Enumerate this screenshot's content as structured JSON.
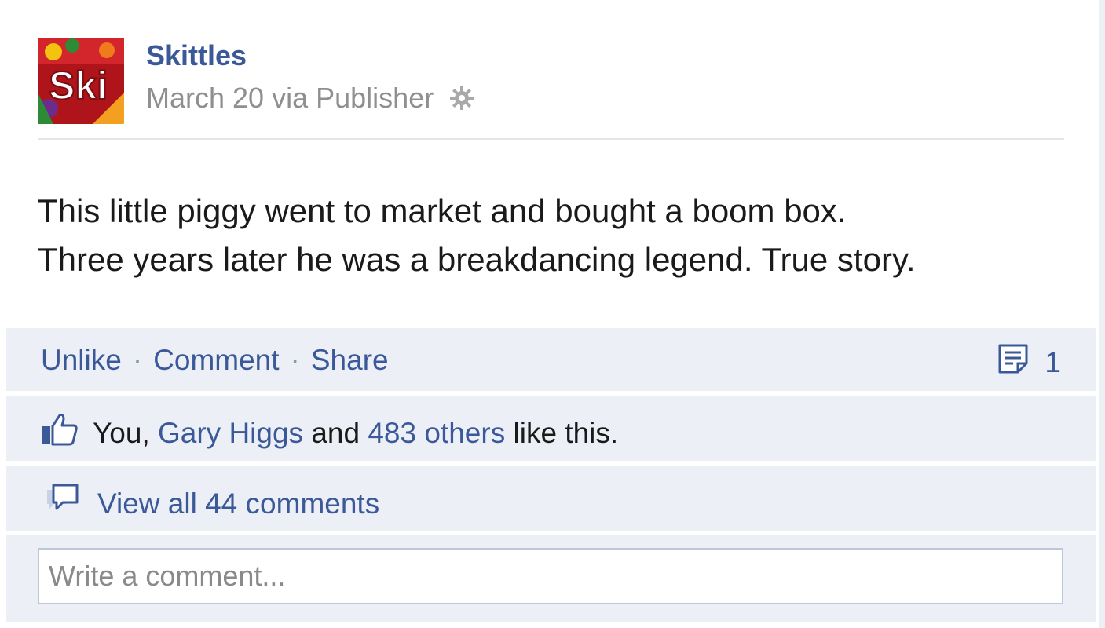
{
  "post": {
    "author": "Skittles",
    "avatar_text": "Ski",
    "date": "March 20",
    "via": "via Publisher",
    "text_line1": "This little piggy went to market and bought a boom box.",
    "text_line2": "Three years later he was a breakdancing legend. True story."
  },
  "actions": {
    "unlike": "Unlike",
    "comment": "Comment",
    "share": "Share",
    "separator": "·",
    "comment_count": "1"
  },
  "likes": {
    "you": "You,",
    "friend": "Gary Higgs",
    "and": "and",
    "others": "483 others",
    "suffix": "like this."
  },
  "comments": {
    "view_all": "View all 44 comments"
  },
  "compose": {
    "placeholder": "Write a comment..."
  },
  "colors": {
    "link": "#3b5998",
    "panel": "#eceff6",
    "meta": "#8f8f8f"
  }
}
